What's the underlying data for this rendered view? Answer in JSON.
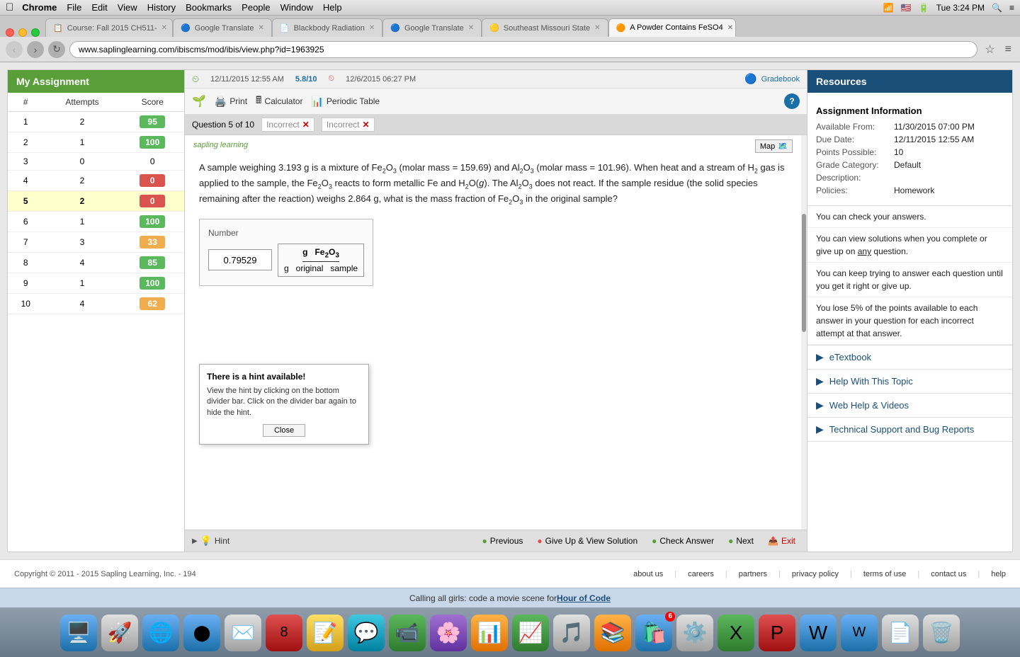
{
  "menubar": {
    "apple": "&#63743;",
    "items": [
      "Chrome",
      "File",
      "Edit",
      "View",
      "History",
      "Bookmarks",
      "People",
      "Window",
      "Help"
    ],
    "bold_item": "Chrome",
    "time": "Tue 3:24 PM"
  },
  "tabs": [
    {
      "id": "tab1",
      "label": "Course: Fall 2015 CH511-",
      "favicon": "📋",
      "active": false
    },
    {
      "id": "tab2",
      "label": "Google Translate",
      "favicon": "🔵",
      "active": false
    },
    {
      "id": "tab3",
      "label": "Blackbody Radiation",
      "favicon": "📄",
      "active": false
    },
    {
      "id": "tab4",
      "label": "Google Translate",
      "favicon": "🔵",
      "active": false
    },
    {
      "id": "tab5",
      "label": "Southeast Missouri State",
      "favicon": "🟡",
      "active": false
    },
    {
      "id": "tab6",
      "label": "A Powder Contains FeSO4",
      "favicon": "🟠",
      "active": true
    }
  ],
  "address_bar": {
    "url": "www.saplinglearning.com/ibiscms/mod/ibis/view.php?id=1963925"
  },
  "left_panel": {
    "title": "My Assignment",
    "columns": [
      "#",
      "Attempts",
      "Score"
    ],
    "rows": [
      {
        "num": 1,
        "attempts": 2,
        "score": 95,
        "color": "green"
      },
      {
        "num": 2,
        "attempts": 1,
        "score": 100,
        "color": "green"
      },
      {
        "num": 3,
        "attempts": 0,
        "score": 0,
        "color": "zero"
      },
      {
        "num": 4,
        "attempts": 2,
        "score": 0,
        "color": "red"
      },
      {
        "num": 5,
        "attempts": 2,
        "score": 0,
        "color": "red",
        "selected": true
      },
      {
        "num": 6,
        "attempts": 1,
        "score": 100,
        "color": "green"
      },
      {
        "num": 7,
        "attempts": 3,
        "score": 33,
        "color": "yellow"
      },
      {
        "num": 8,
        "attempts": 4,
        "score": 85,
        "color": "green"
      },
      {
        "num": 9,
        "attempts": 1,
        "score": 100,
        "color": "green"
      },
      {
        "num": 10,
        "attempts": 4,
        "score": 62,
        "color": "yellow"
      }
    ]
  },
  "question_panel": {
    "timestamp_left": "12/11/2015 12:55 AM",
    "timestamp_score": "5.8/10",
    "timestamp_right": "12/6/2015 06:27 PM",
    "print_btn": "Print",
    "calculator_btn": "Calculator",
    "periodic_btn": "Periodic Table",
    "gradebook_btn": "Gradebook",
    "question_nav": "Question 5 of 10",
    "incorrect1": "Incorrect",
    "incorrect2": "Incorrect",
    "map_btn": "Map",
    "sapling_logo": "sapling learning",
    "question_text": "A sample weighing 3.193 g is a mixture of Fe₂O₃ (molar mass = 159.69) and Al₂O₃ (molar mass = 101.96). When heat and a stream of H₂ gas is applied to the sample, the Fe₂O₃ reacts to form metallic Fe and H₂O(g). The Al₂O₃ does not react. If the sample residue (the solid species remaining after the reaction) weighs 2.864 g, what is the mass fraction of Fe₂O₃ in the original sample?",
    "answer_label": "Number",
    "answer_value": "0.79529",
    "fraction_top": "g  Fe₂O₃",
    "fraction_bottom": "g original sample",
    "hint_title": "There is a hint available!",
    "hint_text": "View the hint by clicking on the bottom divider bar. Click on the divider bar again to hide the hint.",
    "hint_close": "Close",
    "hint_bar_label": "Hint",
    "nav_previous": "Previous",
    "nav_giveup": "Give Up & View Solution",
    "nav_check": "Check Answer",
    "nav_next": "Next",
    "nav_exit": "Exit"
  },
  "resources": {
    "title": "Resources",
    "assignment_info_title": "Assignment Information",
    "fields": [
      {
        "label": "Available From:",
        "value": "11/30/2015 07:00 PM"
      },
      {
        "label": "Due Date:",
        "value": "12/11/2015 12:55 AM"
      },
      {
        "label": "Points Possible:",
        "value": "10"
      },
      {
        "label": "Grade Category:",
        "value": "Default"
      },
      {
        "label": "Description:",
        "value": ""
      },
      {
        "label": "Policies:",
        "value": "Homework"
      }
    ],
    "policies": [
      "You can check your answers.",
      "You can view solutions when you complete or give up on any question.",
      "You can keep trying to answer each question until you get it right or give up.",
      "You lose 5% of the points available to each answer in your question for each incorrect attempt at that answer."
    ],
    "links": [
      {
        "label": "eTextbook"
      },
      {
        "label": "Help With This Topic"
      },
      {
        "label": "Web Help & Videos"
      },
      {
        "label": "Technical Support and Bug Reports"
      }
    ]
  },
  "footer": {
    "copyright": "Copyright © 2011 - 2015 Sapling Learning, Inc. - 194",
    "links": [
      "about us",
      "careers",
      "partners",
      "privacy policy",
      "terms of use",
      "contact us",
      "help"
    ]
  },
  "notification": {
    "text": "Calling all girls: code a movie scene for ",
    "link_text": "Hour of Code"
  },
  "dock": {
    "icons": [
      {
        "emoji": "🖥️",
        "style": "blue",
        "label": "finder"
      },
      {
        "emoji": "🚀",
        "style": "silver",
        "label": "launchpad"
      },
      {
        "emoji": "🌐",
        "style": "blue",
        "label": "safari"
      },
      {
        "emoji": "🔵",
        "style": "blue",
        "label": "chrome"
      },
      {
        "emoji": "✉️",
        "style": "blue",
        "label": "mail"
      },
      {
        "emoji": "📅",
        "style": "red",
        "label": "calendar",
        "date": "8"
      },
      {
        "emoji": "📝",
        "style": "yellow",
        "label": "notes"
      },
      {
        "emoji": "💬",
        "style": "green",
        "label": "messages"
      },
      {
        "emoji": "📱",
        "style": "green",
        "label": "facetime"
      },
      {
        "emoji": "📷",
        "style": "green",
        "label": "photos"
      },
      {
        "emoji": "🗂️",
        "style": "orange",
        "label": "keynote"
      },
      {
        "emoji": "📊",
        "style": "green",
        "label": "numbers"
      },
      {
        "emoji": "🎵",
        "style": "silver",
        "label": "itunes"
      },
      {
        "emoji": "📚",
        "style": "orange",
        "label": "ibooks"
      },
      {
        "emoji": "🛍️",
        "style": "blue",
        "label": "appstore",
        "badge": "6"
      },
      {
        "emoji": "⚙️",
        "style": "silver",
        "label": "system-prefs"
      },
      {
        "emoji": "📊",
        "style": "green",
        "label": "excel"
      },
      {
        "emoji": "📊",
        "style": "red",
        "label": "powerpoint"
      },
      {
        "emoji": "📝",
        "style": "blue",
        "label": "word"
      },
      {
        "emoji": "📝",
        "style": "blue",
        "label": "word2"
      },
      {
        "emoji": "📄",
        "style": "silver",
        "label": "documents"
      },
      {
        "emoji": "🗑️",
        "style": "silver",
        "label": "trash"
      }
    ]
  }
}
